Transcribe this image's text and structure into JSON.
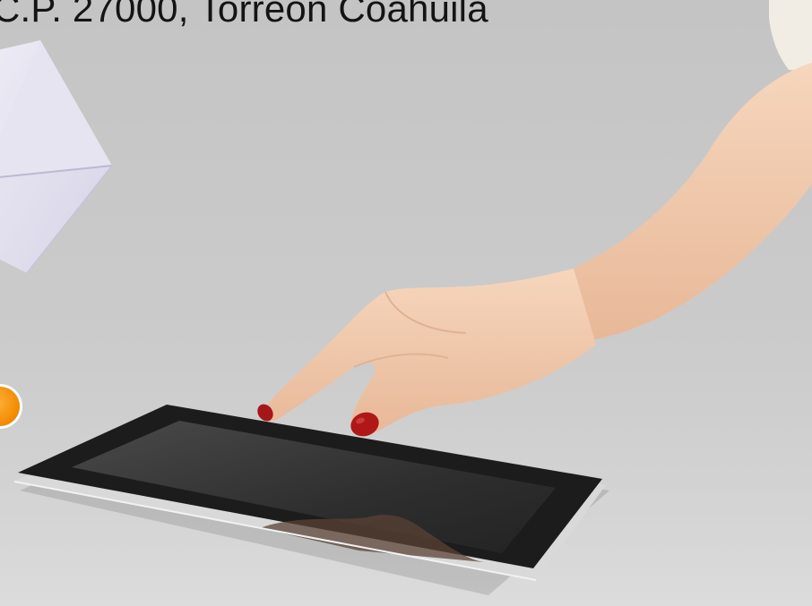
{
  "header": {
    "address_text": "C.P. 27000, Torreón Coahuila"
  },
  "scene": {
    "elements": [
      "envelope-icon",
      "hand",
      "tablet-device",
      "orange-badge"
    ],
    "colors": {
      "background": "#c9c9c9",
      "envelope": "#e2e0ee",
      "skin": "#f1c8a8",
      "nail_polish": "#b01818",
      "tablet_frame": "#1c1c1c",
      "tablet_screen": "#3a3a3a",
      "badge": "#f28a00"
    }
  }
}
